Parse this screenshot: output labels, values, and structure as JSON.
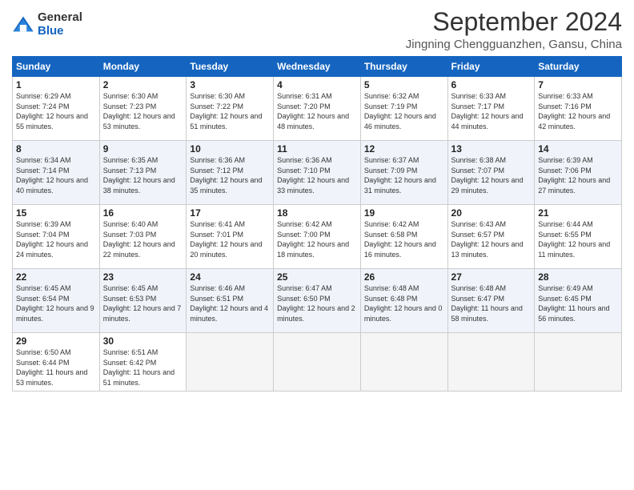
{
  "logo": {
    "general": "General",
    "blue": "Blue"
  },
  "title": "September 2024",
  "location": "Jingning Chengguanzhen, Gansu, China",
  "days_header": [
    "Sunday",
    "Monday",
    "Tuesday",
    "Wednesday",
    "Thursday",
    "Friday",
    "Saturday"
  ],
  "weeks": [
    [
      {
        "day": "1",
        "sunrise": "6:29 AM",
        "sunset": "7:24 PM",
        "daylight": "12 hours and 55 minutes."
      },
      {
        "day": "2",
        "sunrise": "6:30 AM",
        "sunset": "7:23 PM",
        "daylight": "12 hours and 53 minutes."
      },
      {
        "day": "3",
        "sunrise": "6:30 AM",
        "sunset": "7:22 PM",
        "daylight": "12 hours and 51 minutes."
      },
      {
        "day": "4",
        "sunrise": "6:31 AM",
        "sunset": "7:20 PM",
        "daylight": "12 hours and 48 minutes."
      },
      {
        "day": "5",
        "sunrise": "6:32 AM",
        "sunset": "7:19 PM",
        "daylight": "12 hours and 46 minutes."
      },
      {
        "day": "6",
        "sunrise": "6:33 AM",
        "sunset": "7:17 PM",
        "daylight": "12 hours and 44 minutes."
      },
      {
        "day": "7",
        "sunrise": "6:33 AM",
        "sunset": "7:16 PM",
        "daylight": "12 hours and 42 minutes."
      }
    ],
    [
      {
        "day": "8",
        "sunrise": "6:34 AM",
        "sunset": "7:14 PM",
        "daylight": "12 hours and 40 minutes."
      },
      {
        "day": "9",
        "sunrise": "6:35 AM",
        "sunset": "7:13 PM",
        "daylight": "12 hours and 38 minutes."
      },
      {
        "day": "10",
        "sunrise": "6:36 AM",
        "sunset": "7:12 PM",
        "daylight": "12 hours and 35 minutes."
      },
      {
        "day": "11",
        "sunrise": "6:36 AM",
        "sunset": "7:10 PM",
        "daylight": "12 hours and 33 minutes."
      },
      {
        "day": "12",
        "sunrise": "6:37 AM",
        "sunset": "7:09 PM",
        "daylight": "12 hours and 31 minutes."
      },
      {
        "day": "13",
        "sunrise": "6:38 AM",
        "sunset": "7:07 PM",
        "daylight": "12 hours and 29 minutes."
      },
      {
        "day": "14",
        "sunrise": "6:39 AM",
        "sunset": "7:06 PM",
        "daylight": "12 hours and 27 minutes."
      }
    ],
    [
      {
        "day": "15",
        "sunrise": "6:39 AM",
        "sunset": "7:04 PM",
        "daylight": "12 hours and 24 minutes."
      },
      {
        "day": "16",
        "sunrise": "6:40 AM",
        "sunset": "7:03 PM",
        "daylight": "12 hours and 22 minutes."
      },
      {
        "day": "17",
        "sunrise": "6:41 AM",
        "sunset": "7:01 PM",
        "daylight": "12 hours and 20 minutes."
      },
      {
        "day": "18",
        "sunrise": "6:42 AM",
        "sunset": "7:00 PM",
        "daylight": "12 hours and 18 minutes."
      },
      {
        "day": "19",
        "sunrise": "6:42 AM",
        "sunset": "6:58 PM",
        "daylight": "12 hours and 16 minutes."
      },
      {
        "day": "20",
        "sunrise": "6:43 AM",
        "sunset": "6:57 PM",
        "daylight": "12 hours and 13 minutes."
      },
      {
        "day": "21",
        "sunrise": "6:44 AM",
        "sunset": "6:55 PM",
        "daylight": "12 hours and 11 minutes."
      }
    ],
    [
      {
        "day": "22",
        "sunrise": "6:45 AM",
        "sunset": "6:54 PM",
        "daylight": "12 hours and 9 minutes."
      },
      {
        "day": "23",
        "sunrise": "6:45 AM",
        "sunset": "6:53 PM",
        "daylight": "12 hours and 7 minutes."
      },
      {
        "day": "24",
        "sunrise": "6:46 AM",
        "sunset": "6:51 PM",
        "daylight": "12 hours and 4 minutes."
      },
      {
        "day": "25",
        "sunrise": "6:47 AM",
        "sunset": "6:50 PM",
        "daylight": "12 hours and 2 minutes."
      },
      {
        "day": "26",
        "sunrise": "6:48 AM",
        "sunset": "6:48 PM",
        "daylight": "12 hours and 0 minutes."
      },
      {
        "day": "27",
        "sunrise": "6:48 AM",
        "sunset": "6:47 PM",
        "daylight": "11 hours and 58 minutes."
      },
      {
        "day": "28",
        "sunrise": "6:49 AM",
        "sunset": "6:45 PM",
        "daylight": "11 hours and 56 minutes."
      }
    ],
    [
      {
        "day": "29",
        "sunrise": "6:50 AM",
        "sunset": "6:44 PM",
        "daylight": "11 hours and 53 minutes."
      },
      {
        "day": "30",
        "sunrise": "6:51 AM",
        "sunset": "6:42 PM",
        "daylight": "11 hours and 51 minutes."
      },
      null,
      null,
      null,
      null,
      null
    ]
  ]
}
